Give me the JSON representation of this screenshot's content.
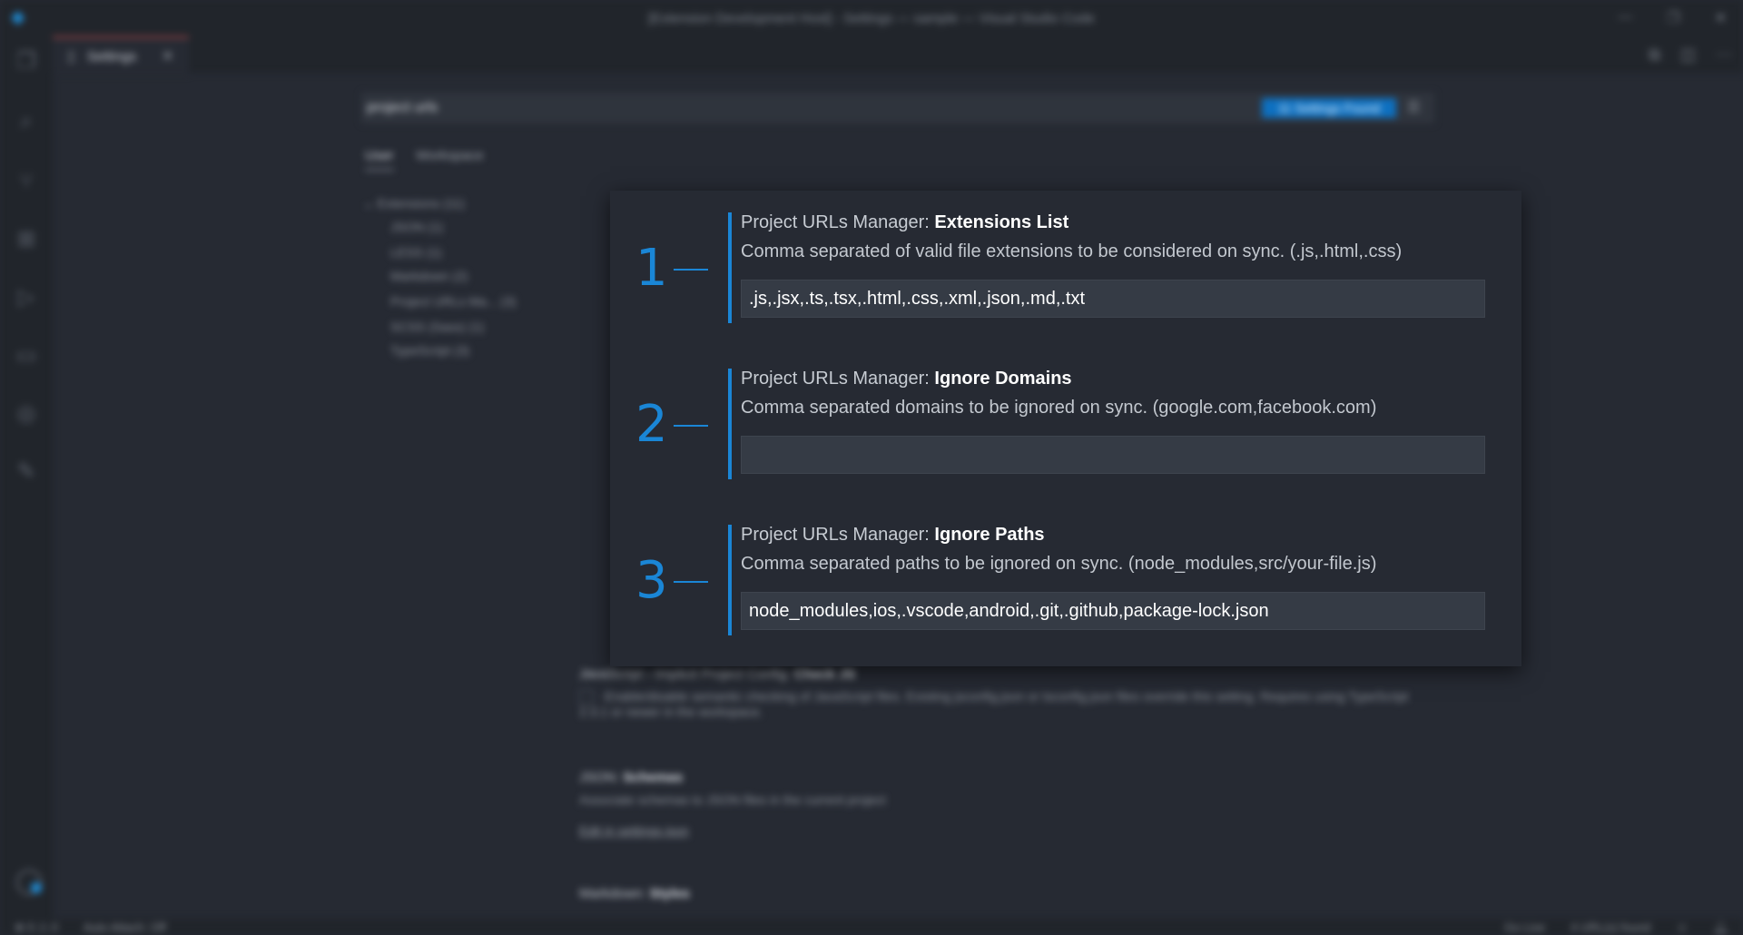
{
  "window": {
    "title": "[Extension Development Host] - Settings — sample — Visual Studio Code"
  },
  "tab": {
    "label": "Settings"
  },
  "search": {
    "query": "project urls",
    "results_badge": "11 Settings Found"
  },
  "scope_tabs": [
    {
      "label": "User"
    },
    {
      "label": "Workspace"
    }
  ],
  "toc": [
    {
      "label": "Extensions (11)"
    },
    {
      "label": "JSON (1)"
    },
    {
      "label": "LESS (1)"
    },
    {
      "label": "Markdown (2)"
    },
    {
      "label": "Project URLs Ma... (3)"
    },
    {
      "label": "SCSS (Sass) (1)"
    },
    {
      "label": "TypeScript (3)"
    }
  ],
  "background_settings": [
    {
      "prefix": "JavaScript › Implicit Project Config: ",
      "key": "Check JS",
      "desc": "Enable/disable semantic checking of JavaScript files. Existing jsconfig.json or tsconfig.json files override this setting. Requires using TypeScript 2.3.1 or newer in the workspace."
    },
    {
      "prefix": "JSON: ",
      "key": "Schemas",
      "desc": "Associate schemas to JSON files in the current project",
      "link": "Edit in settings.json"
    },
    {
      "prefix": "Markdown: ",
      "key": "Styles"
    }
  ],
  "settings": [
    {
      "number": "1",
      "prefix": "Project URLs Manager: ",
      "key": "Extensions List",
      "description": "Comma separated of valid file extensions to be considered on sync. (.js,.html,.css)",
      "value": ".js,.jsx,.ts,.tsx,.html,.css,.xml,.json,.md,.txt"
    },
    {
      "number": "2",
      "prefix": "Project URLs Manager: ",
      "key": "Ignore Domains",
      "description": "Comma separated domains to be ignored on sync. (google.com,facebook.com)",
      "value": ""
    },
    {
      "number": "3",
      "prefix": "Project URLs Manager: ",
      "key": "Ignore Paths",
      "description": "Comma separated paths to be ignored on sync. (node_modules,src/your-file.js)",
      "value": "node_modules,ios,.vscode,android,.git,.github,package-lock.json"
    }
  ],
  "status": {
    "problems": "⊗ 0 ⚠ 0",
    "auto_attach": "Auto Attach: Off",
    "go_live": "Go Live",
    "urls_found": "4 URL(s) found"
  },
  "icons": {
    "explorer": "files-icon",
    "search": "search-icon",
    "scm": "source-control-icon",
    "extensions": "extensions-icon",
    "debug": "run-debug-icon",
    "folder": "folder-icon",
    "remote": "remote-icon",
    "brush": "brush-icon"
  }
}
